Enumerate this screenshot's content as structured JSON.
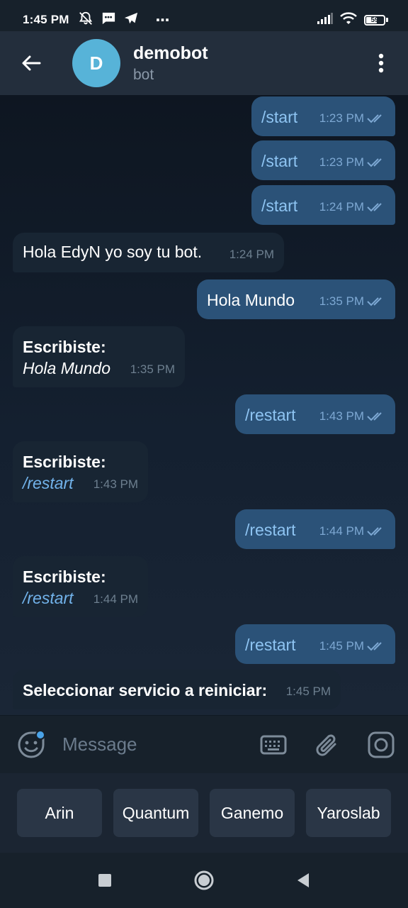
{
  "status": {
    "time": "1:45 PM",
    "dots": "⋯",
    "battery": "59",
    "battery_level": 0.59
  },
  "header": {
    "avatar_letter": "D",
    "title": "demobot",
    "subtitle": "bot"
  },
  "messages": [
    {
      "dir": "out",
      "text": "/start",
      "time": "1:23 PM"
    },
    {
      "dir": "out",
      "text": "/start",
      "time": "1:23 PM"
    },
    {
      "dir": "out",
      "text": "/start",
      "time": "1:24 PM"
    },
    {
      "dir": "in",
      "text": "Hola EdyN yo soy tu bot.",
      "time": "1:24 PM"
    },
    {
      "dir": "out",
      "text": "Hola Mundo",
      "time": "1:35 PM"
    },
    {
      "dir": "in",
      "label": "Escribiste:",
      "text": "Hola Mundo",
      "time": "1:35 PM"
    },
    {
      "dir": "out",
      "text": "/restart",
      "time": "1:43 PM"
    },
    {
      "dir": "in",
      "label": "Escribiste:",
      "text": "/restart",
      "time": "1:43 PM"
    },
    {
      "dir": "out",
      "text": "/restart",
      "time": "1:44 PM"
    },
    {
      "dir": "in",
      "label": "Escribiste:",
      "text": "/restart",
      "time": "1:44 PM"
    },
    {
      "dir": "out",
      "text": "/restart",
      "time": "1:45 PM"
    },
    {
      "dir": "in",
      "text": "Seleccionar servicio a reiniciar:",
      "time": "1:45 PM"
    }
  ],
  "input": {
    "placeholder": "Message"
  },
  "keyboard": {
    "buttons": [
      "Arin",
      "Quantum",
      "Ganemo",
      "Yaroslab"
    ]
  },
  "colors": {
    "outgoing_bubble": "#2b5278",
    "incoming_bubble": "#182533",
    "header": "#232e3c",
    "avatar": "#57b3d8",
    "command": "#72b3eb"
  }
}
